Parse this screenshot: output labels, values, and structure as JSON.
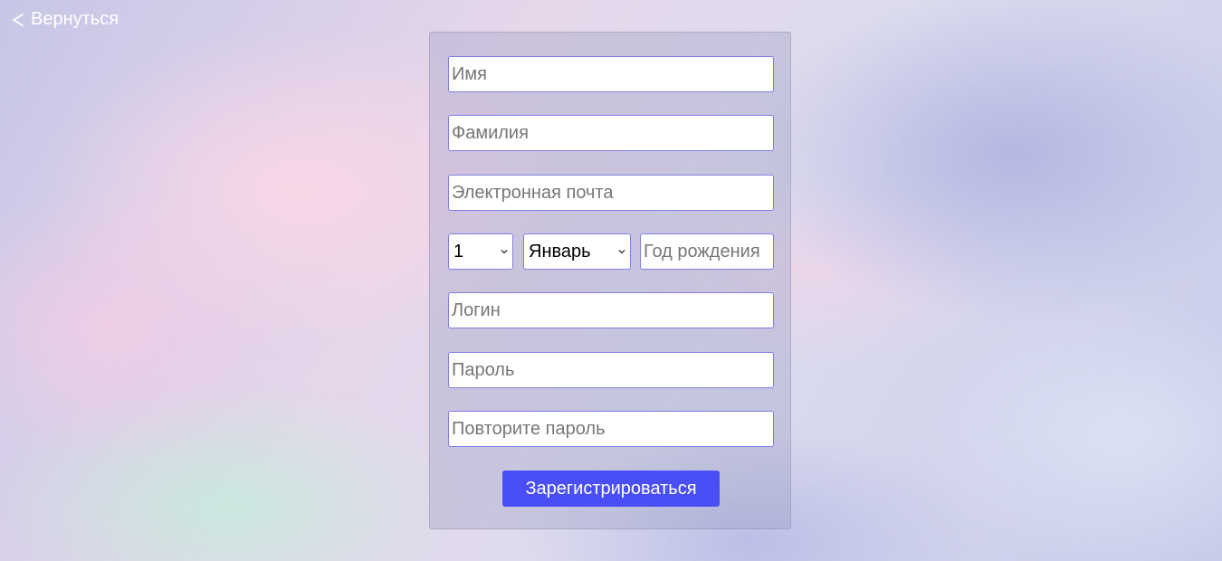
{
  "nav": {
    "back_label": "Вернуться",
    "back_icon": "chevron-left-icon"
  },
  "form": {
    "first_name_placeholder": "Имя",
    "last_name_placeholder": "Фамилия",
    "email_placeholder": "Электронная почта",
    "birth_day_value": "1",
    "birth_month_value": "Январь",
    "birth_year_placeholder": "Год рождения",
    "login_placeholder": "Логин",
    "password_placeholder": "Пароль",
    "password_repeat_placeholder": "Повторите пароль",
    "submit_label": "Зарегистрироваться"
  },
  "colors": {
    "accent": "#4a4ff5",
    "field_border": "#7f7fe6"
  }
}
